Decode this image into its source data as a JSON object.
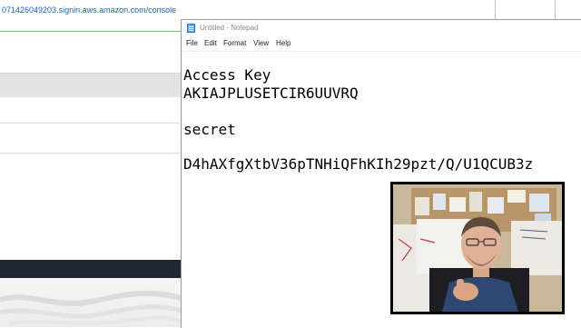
{
  "browser": {
    "url_fragment": "071426049203.signin.aws.amazon.com/console"
  },
  "notepad": {
    "title": "Untitled - Notepad",
    "menu": [
      "File",
      "Edit",
      "Format",
      "View",
      "Help"
    ],
    "lines": [
      "Access Key",
      "AKIAJPLUSETCIR6UUVRQ",
      "",
      "secret",
      "",
      "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"
    ]
  },
  "webcam": {
    "description_icon": "presenter-webcam"
  },
  "colors": {
    "url_blue": "#1e62b6",
    "dark_bar": "#1f2732",
    "green_line": "#6fbf6f"
  }
}
